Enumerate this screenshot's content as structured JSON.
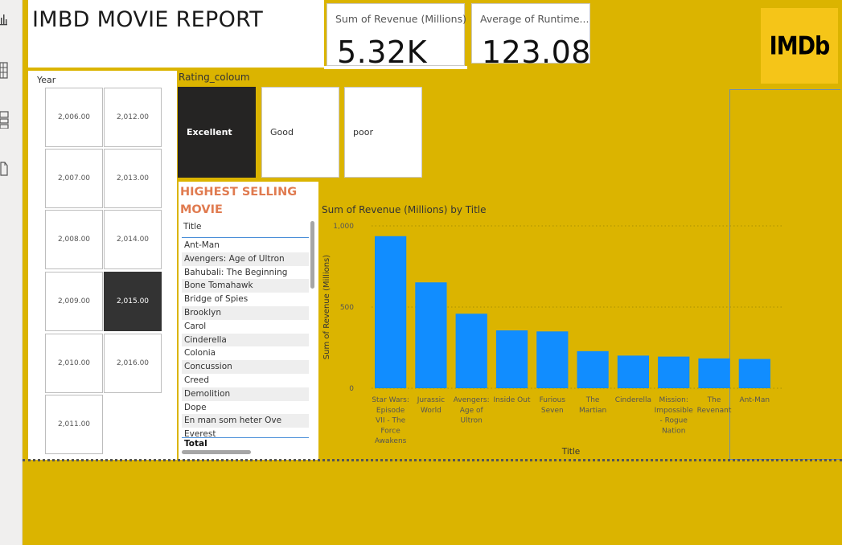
{
  "report": {
    "title": "IMBD MOVIE REPORT"
  },
  "kpis": [
    {
      "label": "Sum of Revenue (Millions)",
      "value": "5.32K"
    },
    {
      "label": "Average of Runtime...",
      "value": "123.08"
    }
  ],
  "logo": {
    "text": "IMDb",
    "color": "#f5c518"
  },
  "rail": {
    "icons": [
      "report-view-icon",
      "table-view-icon",
      "model-view-icon",
      "dax-query-icon"
    ]
  },
  "year_slicer": {
    "header": "Year",
    "tiles": [
      "2,006.00",
      "2,012.00",
      "2,007.00",
      "2,013.00",
      "2,008.00",
      "2,014.00",
      "2,009.00",
      "2,015.00",
      "2,010.00",
      "2,016.00",
      "2,011.00"
    ],
    "selected": "2,015.00"
  },
  "rating_slicer": {
    "header": "Rating_coloum",
    "options": [
      "Excellent",
      "Good",
      "poor"
    ],
    "selected": "Excellent"
  },
  "movie_table": {
    "heading": "HIGHEST SELLING MOVIE",
    "column": "Title",
    "rows": [
      "Ant-Man",
      "Avengers: Age of Ultron",
      "Bahubali: The Beginning",
      "Bone Tomahawk",
      "Bridge of Spies",
      "Brooklyn",
      "Carol",
      "Cinderella",
      "Colonia",
      "Concussion",
      "Creed",
      "Demolition",
      "Dope",
      "En man som heter Ove",
      "Everest"
    ],
    "total_label": "Total"
  },
  "chart_title": "Sum of Revenue (Millions) by Title",
  "chart_data": {
    "type": "bar",
    "categories": [
      "Star Wars: Episode VII - The Force Awakens",
      "Jurassic World",
      "Avengers: Age of Ultron",
      "Inside Out",
      "Furious Seven",
      "The Martian",
      "Cinderella",
      "Mission: Impossible - Rogue Nation",
      "The Revenant",
      "Ant-Man"
    ],
    "category_lines": [
      [
        "Star Wars:",
        "Episode",
        "VII - The",
        "Force",
        "Awakens"
      ],
      [
        "Jurassic",
        "World"
      ],
      [
        "Avengers:",
        "Age of",
        "Ultron"
      ],
      [
        "Inside Out"
      ],
      [
        "Furious",
        "Seven"
      ],
      [
        "The",
        "Martian"
      ],
      [
        "Cinderella"
      ],
      [
        "Mission:",
        "Impossible",
        "- Rogue",
        "Nation"
      ],
      [
        "The",
        "Revenant"
      ],
      [
        "Ant-Man"
      ]
    ],
    "values": [
      936.63,
      652.18,
      458.99,
      356.45,
      350.03,
      228.43,
      201.15,
      195.0,
      183.64,
      180.19
    ],
    "xlabel": "Title",
    "ylabel": "Sum of Revenue (Millions)",
    "ylim": [
      0,
      1000
    ],
    "yticks": [
      0,
      500,
      1000
    ],
    "ytick_labels": [
      "0",
      "500",
      "1,000"
    ],
    "grid": true,
    "bar_color": "#118dff"
  }
}
